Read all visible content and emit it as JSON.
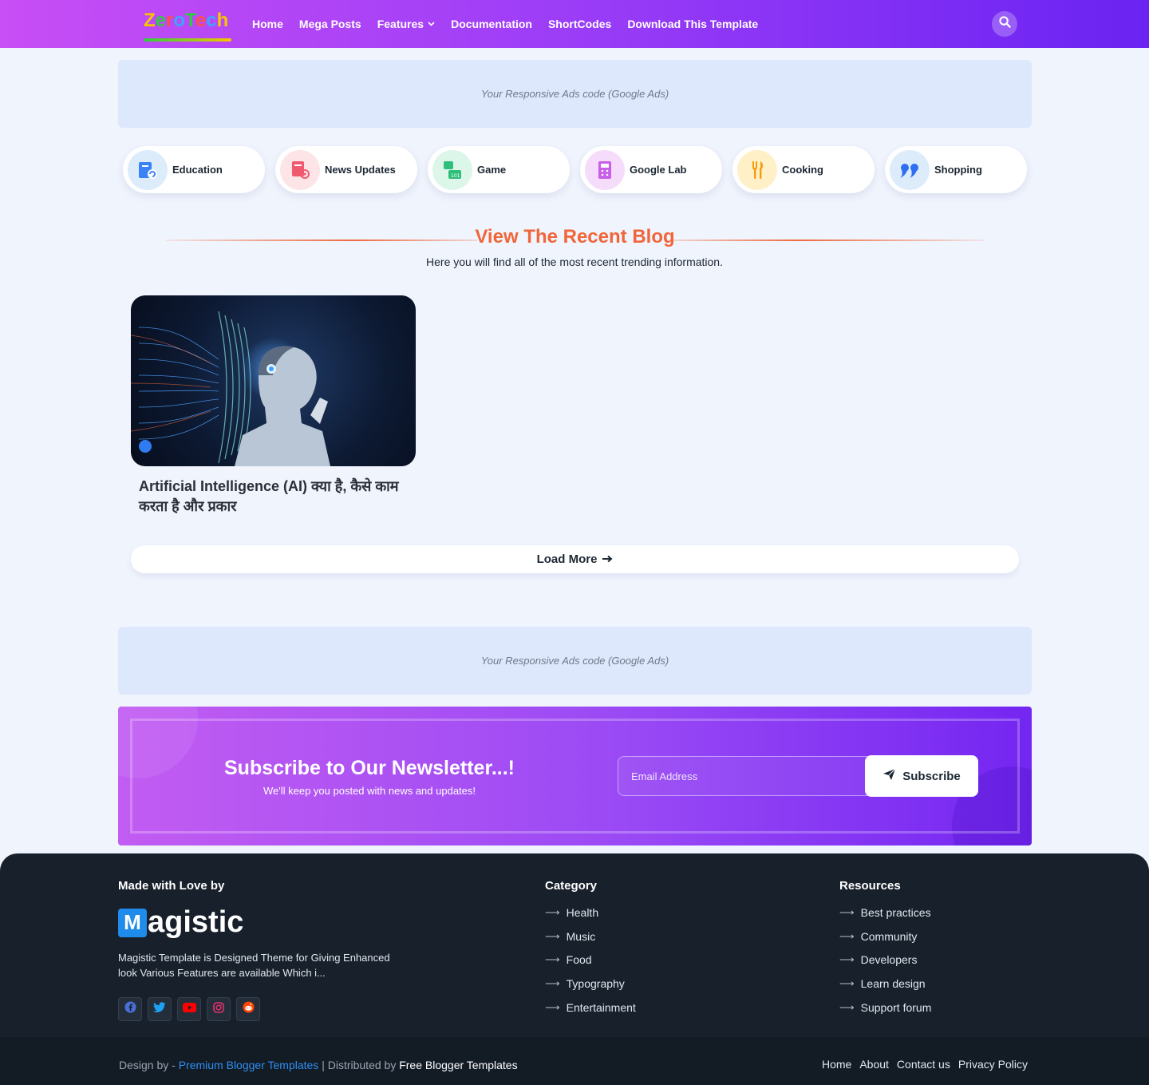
{
  "header": {
    "logo_text": "ZeroTech",
    "nav": [
      "Home",
      "Mega Posts",
      "Features",
      "Documentation",
      "ShortCodes",
      "Download This Template"
    ]
  },
  "ads": {
    "top": "Your Responsive Ads code (Google Ads)",
    "bottom": "Your Responsive Ads code (Google Ads)"
  },
  "categories": [
    {
      "label": "Education",
      "icon": "education-icon",
      "bg": "#dcecfb"
    },
    {
      "label": "News Updates",
      "icon": "news-icon",
      "bg": "#fde4e6"
    },
    {
      "label": "Game",
      "icon": "game-icon",
      "bg": "#ddf6ea"
    },
    {
      "label": "Google Lab",
      "icon": "lab-icon",
      "bg": "#f6dcfb"
    },
    {
      "label": "Cooking",
      "icon": "cooking-icon",
      "bg": "#fff0c8"
    },
    {
      "label": "Shopping",
      "icon": "shopping-icon",
      "bg": "#dcecfb"
    }
  ],
  "section": {
    "title": "View The Recent Blog",
    "subtitle": "Here you will find all of the most recent trending information."
  },
  "post": {
    "title": "Artificial Intelligence (AI) क्या है, कैसे काम करता है और प्रकार"
  },
  "load_more": "Load More",
  "newsletter": {
    "title": "Subscribe to Our Newsletter...!",
    "subtitle": "We'll keep you posted with news and updates!",
    "email_placeholder": "Email Address",
    "button": "Subscribe"
  },
  "footer": {
    "made_with": "Made with Love by",
    "brand_m": "M",
    "brand_rest": "agistic",
    "description": "Magistic Template is Designed Theme for Giving Enhanced look Various Features are available Which i...",
    "category_heading": "Category",
    "categories": [
      "Health",
      "Music",
      "Food",
      "Typography",
      "Entertainment"
    ],
    "resources_heading": "Resources",
    "resources": [
      "Best practices",
      "Community",
      "Developers",
      "Learn design",
      "Support forum"
    ],
    "socials": [
      "facebook-icon",
      "twitter-icon",
      "youtube-icon",
      "instagram-icon",
      "reddit-icon"
    ],
    "credit_prefix": "Design by - ",
    "credit_link": "Premium Blogger Templates",
    "credit_mid": " | Distributed by ",
    "credit_link2": "Free Blogger Templates",
    "bottom_links": [
      "Home",
      "About",
      "Contact us",
      "Privacy Policy"
    ]
  },
  "colors": {
    "accent_orange": "#f0663a",
    "header_gradient_start": "#c84ef5",
    "header_gradient_end": "#6a23f2",
    "footer_bg": "#18202b",
    "link_blue": "#2e8ff0"
  }
}
